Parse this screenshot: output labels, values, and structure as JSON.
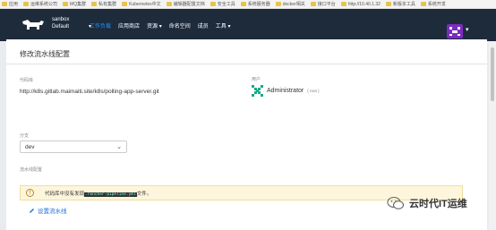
{
  "bookmarks": [
    {
      "label": "应用"
    },
    {
      "label": "运维系统公司"
    },
    {
      "label": "MQ集群"
    },
    {
      "label": "私有集群"
    },
    {
      "label": "Kubernetes中文"
    },
    {
      "label": "编辑器配置文档"
    },
    {
      "label": "安全工具"
    },
    {
      "label": "系统服务器"
    },
    {
      "label": "docker相关"
    },
    {
      "label": "接口平台"
    },
    {
      "label": "http://10.40.1.32"
    },
    {
      "label": "新版本工具"
    },
    {
      "label": "系统开发"
    }
  ],
  "nav": {
    "cluster_name": "sanbox",
    "cluster_env": "Default",
    "links": [
      "工作负载",
      "应用商店",
      "资源",
      "命名空间",
      "成员",
      "工具"
    ]
  },
  "page": {
    "title": "修改流水线配置",
    "repo_label": "代码库",
    "repo_value": "http://k8s.gitlab.maimaiti.site/k8s/polling-app-server.git",
    "owner_label": "用户",
    "owner_name": "Administrator",
    "owner_sub": "( root )",
    "branch_label": "分支",
    "branch_value": "dev",
    "pipeline_label": "流水线配置",
    "warning_before": "代码库中没有发现",
    "warning_code": ".rancher-pipeline.yml",
    "warning_after": "文件。",
    "setup_link": "设置流水线"
  },
  "watermark": {
    "text": "云时代IT运维"
  },
  "colors": {
    "nav_bg": "#1e2b3b",
    "active_link": "#1e90ff",
    "avatar": "#7b2cbf",
    "link": "#1e6fcf"
  }
}
